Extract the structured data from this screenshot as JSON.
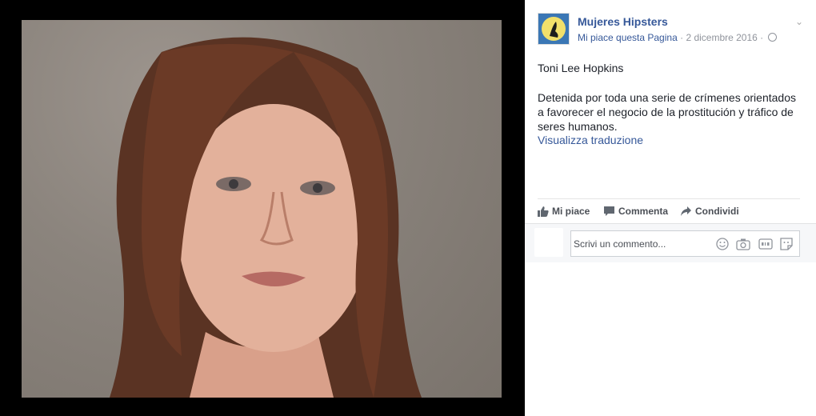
{
  "page": {
    "name": "Mujeres Hipsters",
    "like_page_link": "Mi piace questa Pagina",
    "separator": "·",
    "date": "2 dicembre 2016"
  },
  "post": {
    "title": "Toni Lee Hopkins",
    "body": "Detenida por toda una serie de crímenes orientados a favorecer el negocio de la prostitución y tráfico de seres humanos.",
    "translate_link": "Visualizza traduzione"
  },
  "actions": {
    "like": "Mi piace",
    "comment": "Commenta",
    "share": "Condividi"
  },
  "comment_box": {
    "placeholder": "Scrivi un commento...",
    "icons": [
      "emoji-icon",
      "camera-icon",
      "gif-icon",
      "sticker-icon"
    ]
  },
  "colors": {
    "link": "#365899",
    "background": "#000000",
    "panel": "#ffffff"
  }
}
